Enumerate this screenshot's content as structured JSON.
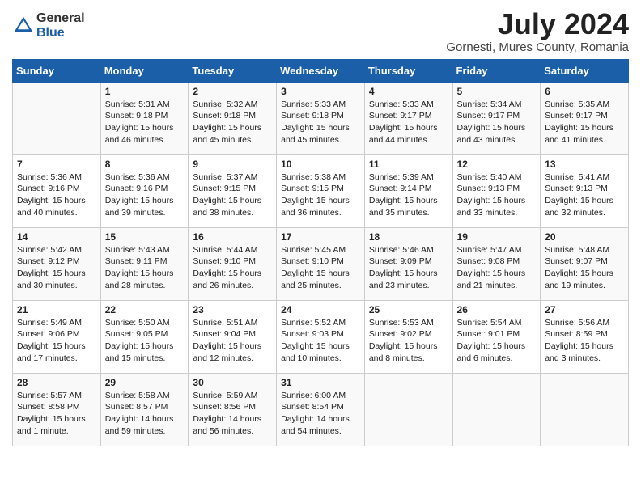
{
  "header": {
    "logo_general": "General",
    "logo_blue": "Blue",
    "month_year": "July 2024",
    "location": "Gornesti, Mures County, Romania"
  },
  "days_of_week": [
    "Sunday",
    "Monday",
    "Tuesday",
    "Wednesday",
    "Thursday",
    "Friday",
    "Saturday"
  ],
  "weeks": [
    [
      {
        "day": "",
        "content": ""
      },
      {
        "day": "1",
        "content": "Sunrise: 5:31 AM\nSunset: 9:18 PM\nDaylight: 15 hours\nand 46 minutes."
      },
      {
        "day": "2",
        "content": "Sunrise: 5:32 AM\nSunset: 9:18 PM\nDaylight: 15 hours\nand 45 minutes."
      },
      {
        "day": "3",
        "content": "Sunrise: 5:33 AM\nSunset: 9:18 PM\nDaylight: 15 hours\nand 45 minutes."
      },
      {
        "day": "4",
        "content": "Sunrise: 5:33 AM\nSunset: 9:17 PM\nDaylight: 15 hours\nand 44 minutes."
      },
      {
        "day": "5",
        "content": "Sunrise: 5:34 AM\nSunset: 9:17 PM\nDaylight: 15 hours\nand 43 minutes."
      },
      {
        "day": "6",
        "content": "Sunrise: 5:35 AM\nSunset: 9:17 PM\nDaylight: 15 hours\nand 41 minutes."
      }
    ],
    [
      {
        "day": "7",
        "content": "Sunrise: 5:36 AM\nSunset: 9:16 PM\nDaylight: 15 hours\nand 40 minutes."
      },
      {
        "day": "8",
        "content": "Sunrise: 5:36 AM\nSunset: 9:16 PM\nDaylight: 15 hours\nand 39 minutes."
      },
      {
        "day": "9",
        "content": "Sunrise: 5:37 AM\nSunset: 9:15 PM\nDaylight: 15 hours\nand 38 minutes."
      },
      {
        "day": "10",
        "content": "Sunrise: 5:38 AM\nSunset: 9:15 PM\nDaylight: 15 hours\nand 36 minutes."
      },
      {
        "day": "11",
        "content": "Sunrise: 5:39 AM\nSunset: 9:14 PM\nDaylight: 15 hours\nand 35 minutes."
      },
      {
        "day": "12",
        "content": "Sunrise: 5:40 AM\nSunset: 9:13 PM\nDaylight: 15 hours\nand 33 minutes."
      },
      {
        "day": "13",
        "content": "Sunrise: 5:41 AM\nSunset: 9:13 PM\nDaylight: 15 hours\nand 32 minutes."
      }
    ],
    [
      {
        "day": "14",
        "content": "Sunrise: 5:42 AM\nSunset: 9:12 PM\nDaylight: 15 hours\nand 30 minutes."
      },
      {
        "day": "15",
        "content": "Sunrise: 5:43 AM\nSunset: 9:11 PM\nDaylight: 15 hours\nand 28 minutes."
      },
      {
        "day": "16",
        "content": "Sunrise: 5:44 AM\nSunset: 9:10 PM\nDaylight: 15 hours\nand 26 minutes."
      },
      {
        "day": "17",
        "content": "Sunrise: 5:45 AM\nSunset: 9:10 PM\nDaylight: 15 hours\nand 25 minutes."
      },
      {
        "day": "18",
        "content": "Sunrise: 5:46 AM\nSunset: 9:09 PM\nDaylight: 15 hours\nand 23 minutes."
      },
      {
        "day": "19",
        "content": "Sunrise: 5:47 AM\nSunset: 9:08 PM\nDaylight: 15 hours\nand 21 minutes."
      },
      {
        "day": "20",
        "content": "Sunrise: 5:48 AM\nSunset: 9:07 PM\nDaylight: 15 hours\nand 19 minutes."
      }
    ],
    [
      {
        "day": "21",
        "content": "Sunrise: 5:49 AM\nSunset: 9:06 PM\nDaylight: 15 hours\nand 17 minutes."
      },
      {
        "day": "22",
        "content": "Sunrise: 5:50 AM\nSunset: 9:05 PM\nDaylight: 15 hours\nand 15 minutes."
      },
      {
        "day": "23",
        "content": "Sunrise: 5:51 AM\nSunset: 9:04 PM\nDaylight: 15 hours\nand 12 minutes."
      },
      {
        "day": "24",
        "content": "Sunrise: 5:52 AM\nSunset: 9:03 PM\nDaylight: 15 hours\nand 10 minutes."
      },
      {
        "day": "25",
        "content": "Sunrise: 5:53 AM\nSunset: 9:02 PM\nDaylight: 15 hours\nand 8 minutes."
      },
      {
        "day": "26",
        "content": "Sunrise: 5:54 AM\nSunset: 9:01 PM\nDaylight: 15 hours\nand 6 minutes."
      },
      {
        "day": "27",
        "content": "Sunrise: 5:56 AM\nSunset: 8:59 PM\nDaylight: 15 hours\nand 3 minutes."
      }
    ],
    [
      {
        "day": "28",
        "content": "Sunrise: 5:57 AM\nSunset: 8:58 PM\nDaylight: 15 hours\nand 1 minute."
      },
      {
        "day": "29",
        "content": "Sunrise: 5:58 AM\nSunset: 8:57 PM\nDaylight: 14 hours\nand 59 minutes."
      },
      {
        "day": "30",
        "content": "Sunrise: 5:59 AM\nSunset: 8:56 PM\nDaylight: 14 hours\nand 56 minutes."
      },
      {
        "day": "31",
        "content": "Sunrise: 6:00 AM\nSunset: 8:54 PM\nDaylight: 14 hours\nand 54 minutes."
      },
      {
        "day": "",
        "content": ""
      },
      {
        "day": "",
        "content": ""
      },
      {
        "day": "",
        "content": ""
      }
    ]
  ]
}
